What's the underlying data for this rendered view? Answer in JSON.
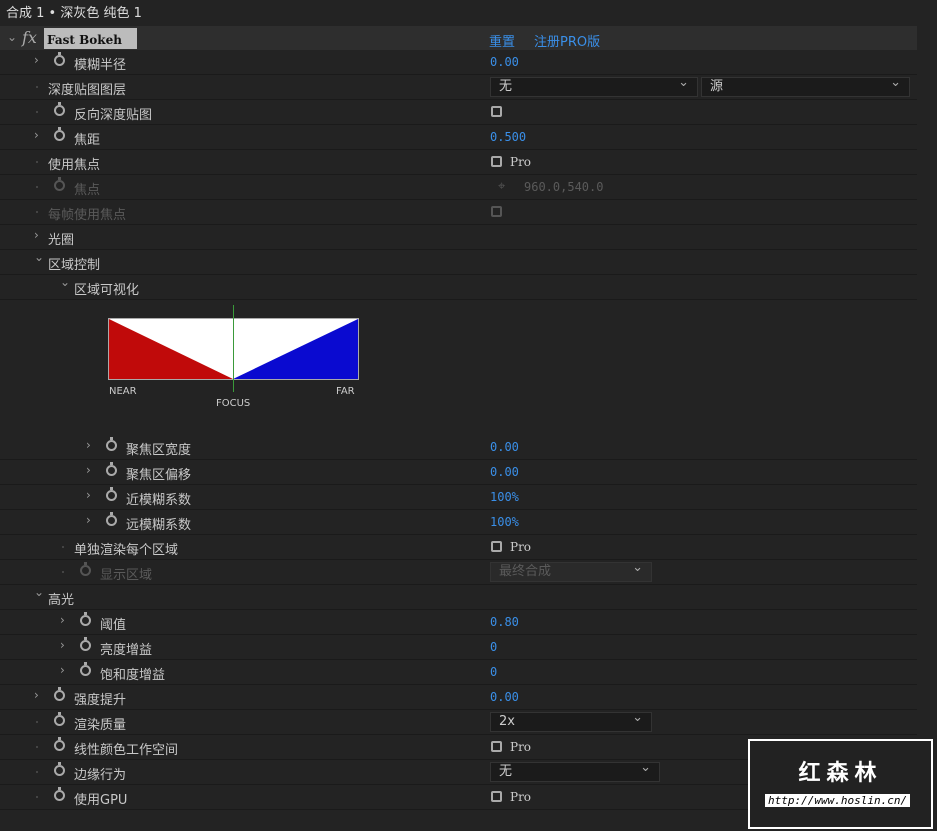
{
  "title": "合成 1 • 深灰色 纯色 1",
  "effect": {
    "name": "Fast Bokeh",
    "fx": "fx",
    "reset": "重置",
    "register": "注册PRO版"
  },
  "rows": [
    {
      "label": "模糊半径",
      "level": 1,
      "twirl": ">",
      "sw": true,
      "type": "value",
      "value": "0.00"
    },
    {
      "label": "深度贴图图层",
      "level": 1,
      "type": "dd2",
      "value": "无",
      "value2": "源"
    },
    {
      "label": "反向深度贴图",
      "level": 1,
      "sw": true,
      "type": "check"
    },
    {
      "label": "焦距",
      "level": 1,
      "twirl": ">",
      "sw": true,
      "type": "value",
      "value": "0.500"
    },
    {
      "label": "使用焦点",
      "level": 1,
      "type": "check",
      "pro": "Pro"
    },
    {
      "label": "焦点",
      "level": 1,
      "sw": true,
      "dis": true,
      "type": "point",
      "value": "960.0,540.0"
    },
    {
      "label": "每帧使用焦点",
      "level": 1,
      "dis": true,
      "type": "check"
    },
    {
      "label": "光圈",
      "level": 1,
      "twirl": ">"
    },
    {
      "label": "区域控制",
      "level": 1,
      "twirl": "v"
    },
    {
      "label": "区域可视化",
      "level": 2,
      "twirl": "v"
    },
    {
      "viz": true
    },
    {
      "label": "聚焦区宽度",
      "level": 3,
      "twirl": ">",
      "sw": true,
      "type": "value",
      "value": "0.00"
    },
    {
      "label": "聚焦区偏移",
      "level": 3,
      "twirl": ">",
      "sw": true,
      "type": "value",
      "value": "0.00"
    },
    {
      "label": "近模糊系数",
      "level": 3,
      "twirl": ">",
      "sw": true,
      "type": "value",
      "value": "100%"
    },
    {
      "label": "远模糊系数",
      "level": 3,
      "twirl": ">",
      "sw": true,
      "type": "value",
      "value": "100%"
    },
    {
      "label": "单独渲染每个区域",
      "level": 2,
      "type": "check",
      "pro": "Pro"
    },
    {
      "label": "显示区域",
      "level": 2,
      "sw": true,
      "dis": true,
      "type": "dd",
      "value": "最终合成"
    },
    {
      "label": "高光",
      "level": 1,
      "twirl": "v"
    },
    {
      "label": "阈值",
      "level": 2,
      "twirl": ">",
      "sw": true,
      "type": "value",
      "value": "0.80"
    },
    {
      "label": "亮度增益",
      "level": 2,
      "twirl": ">",
      "sw": true,
      "type": "value",
      "value": "0"
    },
    {
      "label": "饱和度增益",
      "level": 2,
      "twirl": ">",
      "sw": true,
      "type": "value",
      "value": "0"
    },
    {
      "label": "强度提升",
      "level": 1,
      "twirl": ">",
      "sw": true,
      "type": "value",
      "value": "0.00"
    },
    {
      "label": "渲染质量",
      "level": 1,
      "sw": true,
      "type": "dd",
      "value": "2x"
    },
    {
      "label": "线性颜色工作空间",
      "level": 1,
      "sw": true,
      "type": "check",
      "pro": "Pro"
    },
    {
      "label": "边缘行为",
      "level": 1,
      "sw": true,
      "type": "dd",
      "value": "无"
    },
    {
      "label": "使用GPU",
      "level": 1,
      "sw": true,
      "type": "check",
      "pro": "Pro"
    }
  ],
  "viz": {
    "near": "NEAR",
    "focus": "FOCUS",
    "far": "FAR",
    "near_color": "#c00a0a",
    "far_color": "#0a0ad0"
  },
  "watermark": {
    "title": "红森林",
    "url": "http://www.hoslin.cn/"
  }
}
